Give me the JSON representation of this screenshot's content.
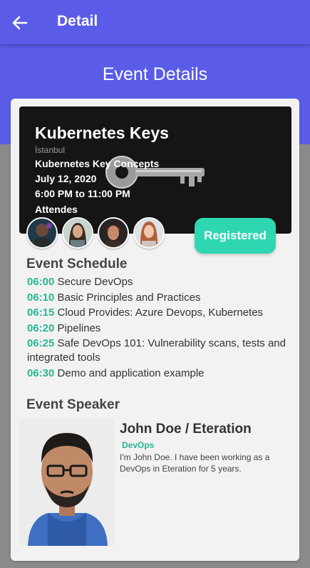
{
  "appbar": {
    "title": "Detail"
  },
  "header": {
    "title": "Event Details"
  },
  "banner": {
    "title": "Kubernetes Keys",
    "city": "İstanbul",
    "subtitle": "Kubernetes Key Concepts",
    "date": "July 12, 2020",
    "time": "6:00 PM to 11:00 PM",
    "attendees_label": "Attendes"
  },
  "register": {
    "label": "Registered"
  },
  "schedule": {
    "title": "Event Schedule",
    "items": [
      {
        "time": "06:00",
        "text": "Secure DevOps"
      },
      {
        "time": "06:10",
        "text": "Basic Principles and Practices"
      },
      {
        "time": "06:15",
        "text": "Cloud Provides: Azure Devops, Kubernetes"
      },
      {
        "time": "06:20",
        "text": "Pipelines"
      },
      {
        "time": "06:25",
        "text": "Safe DevOps 101: Vulnerability scans, tests and integrated tools"
      },
      {
        "time": "06:30",
        "text": "Demo and application example"
      }
    ]
  },
  "speaker": {
    "section_title": "Event Speaker",
    "name": "John Doe / Eteration",
    "role": "DevOps",
    "bio": "I'm John Doe. I have been working as a DevOps in Eteration for 5 years."
  },
  "colors": {
    "primary": "#5a5ce8",
    "accent": "#2fd6b2",
    "time": "#2ab592"
  },
  "icons": {
    "back": "arrow-left-icon"
  }
}
